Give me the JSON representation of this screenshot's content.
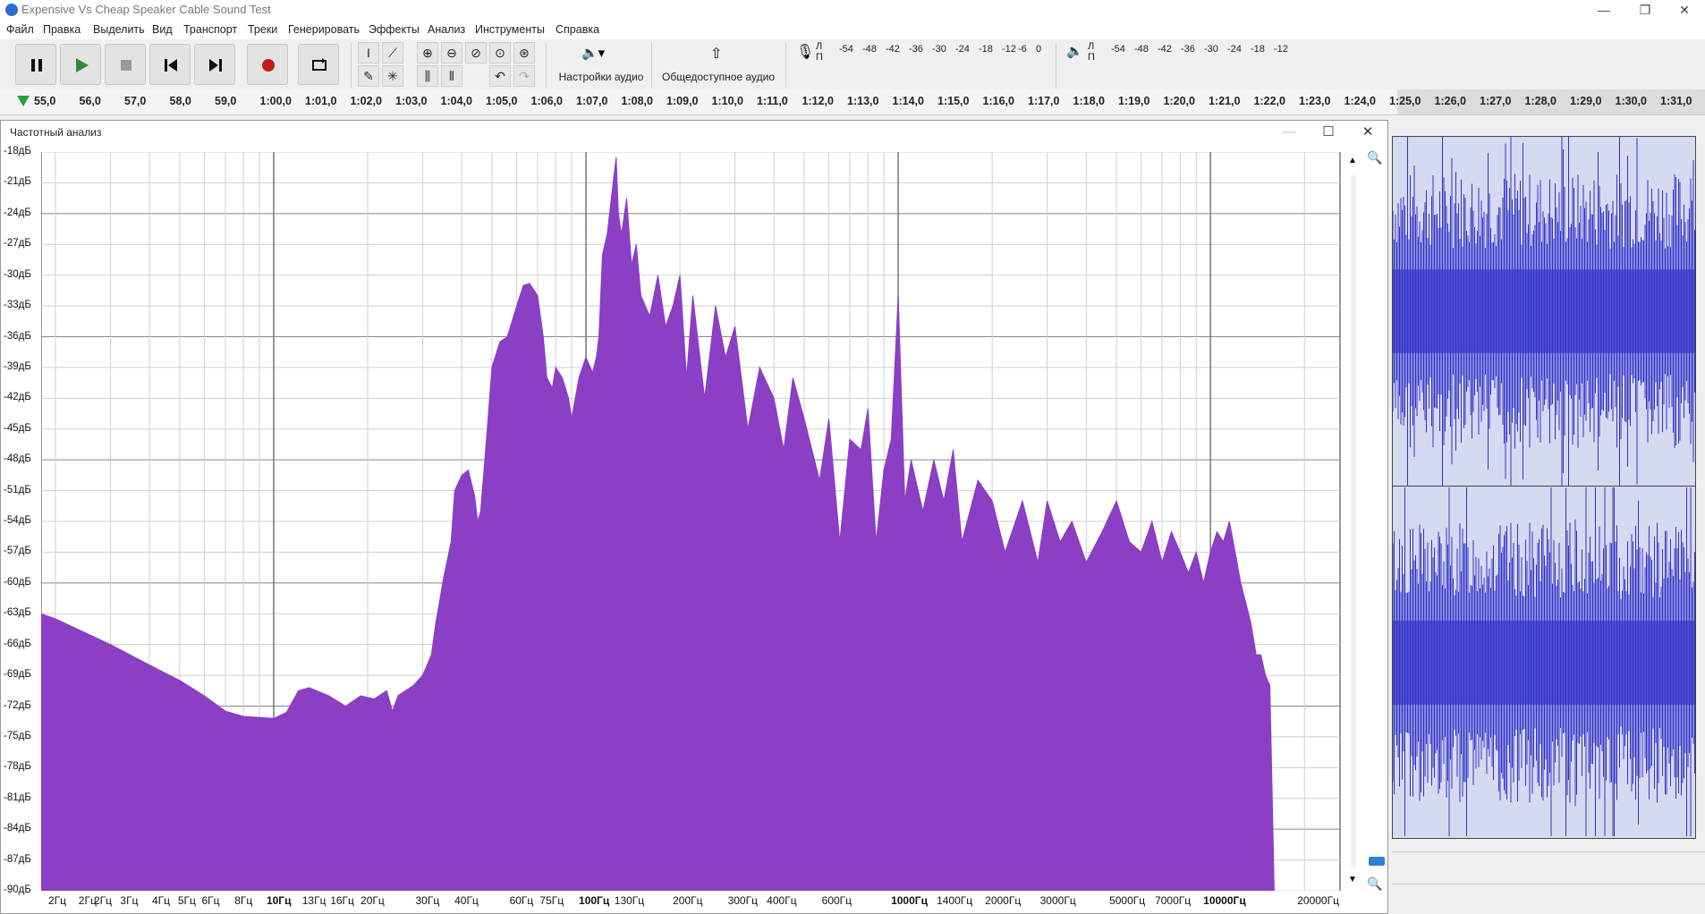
{
  "window": {
    "title": "Expensive Vs Cheap Speaker Cable Sound Test",
    "minimize": "—",
    "restore": "❐",
    "close": "✕"
  },
  "menu": [
    "Файл",
    "Правка",
    "Выделить",
    "Вид",
    "Транспорт",
    "Треки",
    "Генерировать",
    "Эффекты",
    "Анализ",
    "Инструменты",
    "Справка"
  ],
  "toolbar": {
    "audio_settings_label": "Настройки аудио",
    "share_audio_label": "Общедоступное аудио",
    "record_meter_scale": [
      "-54",
      "-48",
      "-42",
      "-36",
      "-30",
      "-24",
      "-18",
      "-12",
      "-6",
      "0"
    ],
    "play_meter_scale": [
      "-54",
      "-48",
      "-42",
      "-36",
      "-30",
      "-24",
      "-18",
      "-12"
    ],
    "meter_channels": [
      "Л",
      "П"
    ]
  },
  "timeline": {
    "ticks": [
      "55,0",
      "56,0",
      "57,0",
      "58,0",
      "59,0",
      "1:00,0",
      "1:01,0",
      "1:02,0",
      "1:03,0",
      "1:04,0",
      "1:05,0",
      "1:06,0",
      "1:07,0",
      "1:08,0",
      "1:09,0",
      "1:10,0",
      "1:11,0",
      "1:12,0",
      "1:13,0",
      "1:14,0",
      "1:15,0",
      "1:16,0",
      "1:17,0",
      "1:18,0",
      "1:19,0",
      "1:20,0",
      "1:21,0",
      "1:22,0",
      "1:23,0",
      "1:24,0",
      "1:25,0",
      "1:26,0",
      "1:27,0",
      "1:28,0",
      "1:29,0",
      "1:30,0",
      "1:31,0"
    ]
  },
  "dialog": {
    "title": "Частотный анализ",
    "minimize": "—",
    "maximize": "☐",
    "close": "✕"
  },
  "colors": {
    "spectrum_fill": "#8a3fc4",
    "waveform": "#3232c8",
    "waveform_bg": "#d6daf0",
    "record_button": "#c41a1a",
    "play_button": "#2e8b32"
  },
  "chart_data": {
    "type": "area",
    "title": "",
    "xlabel": "",
    "ylabel": "",
    "x_scale": "log",
    "ylim": [
      -90,
      -18
    ],
    "xlim": [
      1.8,
      26000
    ],
    "y_ticks": [
      "-18дБ",
      "-21дБ",
      "-24дБ",
      "-27дБ",
      "-30дБ",
      "-33дБ",
      "-36дБ",
      "-39дБ",
      "-42дБ",
      "-45дБ",
      "-48дБ",
      "-51дБ",
      "-54дБ",
      "-57дБ",
      "-60дБ",
      "-63дБ",
      "-66дБ",
      "-69дБ",
      "-72дБ",
      "-75дБ",
      "-78дБ",
      "-81дБ",
      "-84дБ",
      "-87дБ",
      "-90дБ"
    ],
    "y_tick_values": [
      -18,
      -21,
      -24,
      -27,
      -30,
      -33,
      -36,
      -39,
      -42,
      -45,
      -48,
      -51,
      -54,
      -57,
      -60,
      -63,
      -66,
      -69,
      -72,
      -75,
      -78,
      -81,
      -84,
      -87,
      -90
    ],
    "x_ticks": [
      {
        "label": "2Гц",
        "value": 2
      },
      {
        "label": "2Гц",
        "value": 2.5
      },
      {
        "label": "2Гц",
        "value": 2.8
      },
      {
        "label": "3Гц",
        "value": 3.4
      },
      {
        "label": "4Гц",
        "value": 4.3
      },
      {
        "label": "5Гц",
        "value": 5.2
      },
      {
        "label": "6Гц",
        "value": 6.2
      },
      {
        "label": "8Гц",
        "value": 7.9
      },
      {
        "label": "10Гц",
        "value": 10
      },
      {
        "label": "13Гц",
        "value": 13
      },
      {
        "label": "16Гц",
        "value": 16
      },
      {
        "label": "20Гц",
        "value": 20
      },
      {
        "label": "30Гц",
        "value": 30
      },
      {
        "label": "40Гц",
        "value": 40
      },
      {
        "label": "60Гц",
        "value": 60
      },
      {
        "label": "75Гц",
        "value": 75
      },
      {
        "label": "100Гц",
        "value": 100
      },
      {
        "label": "130Гц",
        "value": 130
      },
      {
        "label": "200Гц",
        "value": 200
      },
      {
        "label": "300Гц",
        "value": 300
      },
      {
        "label": "400Гц",
        "value": 400
      },
      {
        "label": "600Гц",
        "value": 600
      },
      {
        "label": "1000Гц",
        "value": 1000
      },
      {
        "label": "1400Гц",
        "value": 1400
      },
      {
        "label": "2000Гц",
        "value": 2000
      },
      {
        "label": "3000Гц",
        "value": 3000
      },
      {
        "label": "5000Гц",
        "value": 5000
      },
      {
        "label": "7000Гц",
        "value": 7000
      },
      {
        "label": "10000Гц",
        "value": 10000
      },
      {
        "label": "20000Гц",
        "value": 20000
      }
    ],
    "major_x_values": [
      10,
      100,
      1000,
      10000
    ],
    "series": [
      {
        "values": [
          [
            1.8,
            -63
          ],
          [
            2,
            -63.5
          ],
          [
            3,
            -66
          ],
          [
            4,
            -68
          ],
          [
            5,
            -69.5
          ],
          [
            6,
            -71
          ],
          [
            7,
            -72.5
          ],
          [
            8,
            -73
          ],
          [
            10,
            -73.2
          ],
          [
            11,
            -72.6
          ],
          [
            12,
            -70.5
          ],
          [
            13,
            -70.2
          ],
          [
            15,
            -71
          ],
          [
            17,
            -72
          ],
          [
            19,
            -71
          ],
          [
            21,
            -71.3
          ],
          [
            23,
            -70.5
          ],
          [
            24,
            -72.5
          ],
          [
            25,
            -71
          ],
          [
            28,
            -70
          ],
          [
            30,
            -69
          ],
          [
            32,
            -67
          ],
          [
            33,
            -64
          ],
          [
            35,
            -59.5
          ],
          [
            37,
            -56
          ],
          [
            38,
            -51
          ],
          [
            40,
            -49.5
          ],
          [
            42,
            -49
          ],
          [
            44,
            -51.5
          ],
          [
            45,
            -54
          ],
          [
            46,
            -53
          ],
          [
            48,
            -46
          ],
          [
            50,
            -39
          ],
          [
            53,
            -36.5
          ],
          [
            56,
            -36
          ],
          [
            60,
            -33
          ],
          [
            63,
            -31
          ],
          [
            66,
            -30.8
          ],
          [
            70,
            -32
          ],
          [
            73,
            -36
          ],
          [
            75,
            -40
          ],
          [
            78,
            -41
          ],
          [
            80,
            -39
          ],
          [
            84,
            -40
          ],
          [
            88,
            -42
          ],
          [
            90,
            -44
          ],
          [
            95,
            -40
          ],
          [
            100,
            -38
          ],
          [
            105,
            -39.5
          ],
          [
            108,
            -38
          ],
          [
            110,
            -36
          ],
          [
            113,
            -28
          ],
          [
            117,
            -26
          ],
          [
            120,
            -23
          ],
          [
            125,
            -18.5
          ],
          [
            127,
            -24
          ],
          [
            130,
            -26
          ],
          [
            135,
            -22.5
          ],
          [
            140,
            -29
          ],
          [
            145,
            -27
          ],
          [
            150,
            -32
          ],
          [
            160,
            -34
          ],
          [
            170,
            -30
          ],
          [
            180,
            -35
          ],
          [
            190,
            -33
          ],
          [
            200,
            -30
          ],
          [
            210,
            -40
          ],
          [
            220,
            -32
          ],
          [
            240,
            -42
          ],
          [
            260,
            -33
          ],
          [
            280,
            -38
          ],
          [
            300,
            -35
          ],
          [
            330,
            -45
          ],
          [
            360,
            -39
          ],
          [
            400,
            -42
          ],
          [
            430,
            -47
          ],
          [
            460,
            -40
          ],
          [
            500,
            -44
          ],
          [
            560,
            -50
          ],
          [
            600,
            -44
          ],
          [
            650,
            -56
          ],
          [
            700,
            -46
          ],
          [
            760,
            -47
          ],
          [
            800,
            -43
          ],
          [
            850,
            -56
          ],
          [
            900,
            -49
          ],
          [
            950,
            -46
          ],
          [
            1000,
            -32
          ],
          [
            1050,
            -52
          ],
          [
            1100,
            -48
          ],
          [
            1200,
            -53
          ],
          [
            1300,
            -48
          ],
          [
            1400,
            -52
          ],
          [
            1500,
            -47
          ],
          [
            1600,
            -56
          ],
          [
            1800,
            -50
          ],
          [
            2000,
            -52
          ],
          [
            2200,
            -57
          ],
          [
            2500,
            -52
          ],
          [
            2800,
            -58
          ],
          [
            3000,
            -52
          ],
          [
            3300,
            -56
          ],
          [
            3600,
            -54
          ],
          [
            4000,
            -58
          ],
          [
            4500,
            -55
          ],
          [
            5000,
            -52
          ],
          [
            5500,
            -56
          ],
          [
            6000,
            -57
          ],
          [
            6500,
            -54
          ],
          [
            7000,
            -58
          ],
          [
            7500,
            -55
          ],
          [
            8000,
            -57
          ],
          [
            8500,
            -59
          ],
          [
            9000,
            -57
          ],
          [
            9500,
            -60
          ],
          [
            10000,
            -57
          ],
          [
            10500,
            -55
          ],
          [
            11000,
            -56
          ],
          [
            11500,
            -54
          ],
          [
            12000,
            -57
          ],
          [
            12500,
            -60
          ],
          [
            13000,
            -62
          ],
          [
            13500,
            -64
          ],
          [
            14000,
            -67
          ],
          [
            14500,
            -67
          ],
          [
            15000,
            -69
          ],
          [
            15500,
            -70
          ],
          [
            16000,
            -90
          ]
        ]
      }
    ]
  }
}
